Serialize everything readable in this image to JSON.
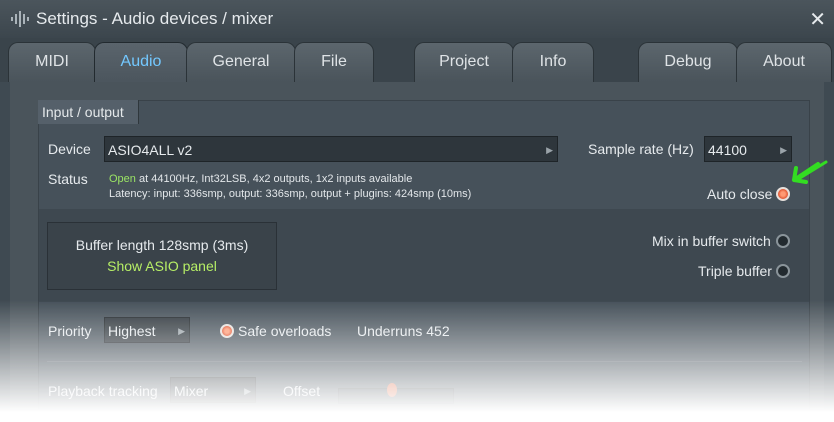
{
  "window": {
    "title": "Settings - Audio devices / mixer",
    "close": "✕"
  },
  "tabs": [
    {
      "label": "MIDI"
    },
    {
      "label": "Audio"
    },
    {
      "label": "General"
    },
    {
      "label": "File"
    },
    {
      "label": "Project"
    },
    {
      "label": "Info"
    },
    {
      "label": "Debug"
    },
    {
      "label": "About"
    }
  ],
  "active_tab": "Audio",
  "section": {
    "title": "Input / output"
  },
  "device": {
    "label": "Device",
    "value": "ASIO4ALL v2"
  },
  "sample_rate": {
    "label": "Sample rate (Hz)",
    "value": "44100"
  },
  "status": {
    "label": "Status",
    "open": "Open",
    "line1_rest": " at 44100Hz, Int32LSB, 4x2 outputs, 1x2 inputs available",
    "line2": "Latency: input: 336smp, output: 336smp, output + plugins: 424smp (10ms)"
  },
  "auto_close": {
    "label": "Auto close",
    "on": true
  },
  "buffer": {
    "length_text": "Buffer length 128smp (3ms)",
    "asio_link": "Show ASIO panel"
  },
  "mix_in_buffer_switch": {
    "label": "Mix in buffer switch",
    "on": false
  },
  "triple_buffer": {
    "label": "Triple buffer",
    "on": false
  },
  "priority": {
    "label": "Priority",
    "value": "Highest"
  },
  "safe_overloads": {
    "label": "Safe overloads",
    "on": true
  },
  "underruns": {
    "text": "Underruns 452"
  },
  "playback_tracking": {
    "label": "Playback tracking",
    "value": "Mixer"
  },
  "offset": {
    "label": "Offset"
  },
  "colors": {
    "accent_tab": "#73c8ff",
    "status_open": "#9be564",
    "link": "#b6ee66",
    "annotation_arrow": "#33dd22"
  }
}
